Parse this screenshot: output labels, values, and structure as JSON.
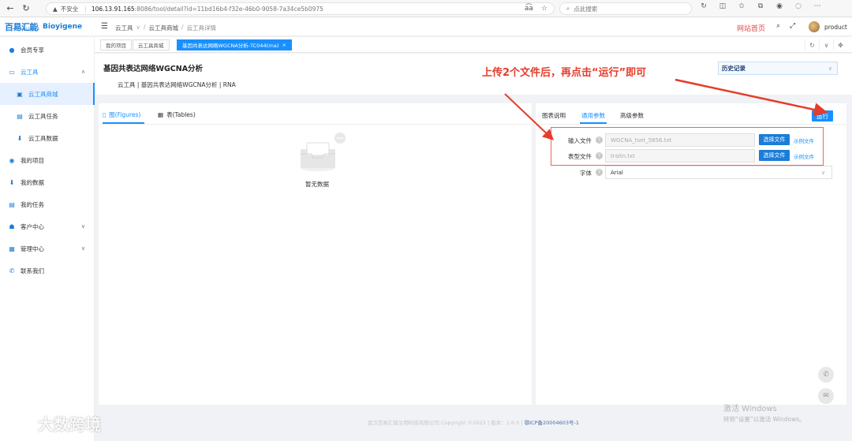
{
  "browser": {
    "insecure_label": "不安全",
    "url_host": "106.13.91.165",
    "url_path": ":8086/tool/detail?id=11bd16b4-f32e-46b0-9058-7a34ce5b0975",
    "search_placeholder": "点此搜索"
  },
  "header": {
    "logo_cn": "百易汇能",
    "logo_sub": "BIOYIGENE",
    "logo_en": "Bioyigene",
    "breadcrumb": [
      "云工具",
      "云工具商城",
      "云工具详情"
    ],
    "site_home": "网站首页",
    "user_name": "product"
  },
  "tabs": [
    {
      "label": "我的项目"
    },
    {
      "label": "云工具商城"
    },
    {
      "label": "基因共表达网络WGCNA分析-TC044(rna)"
    }
  ],
  "sidebar": {
    "items": [
      {
        "label": "会员专享",
        "icon": "member-icon"
      },
      {
        "label": "云工具",
        "icon": "cloud-icon"
      },
      {
        "label": "云工具商城",
        "icon": "store-icon"
      },
      {
        "label": "云工具任务",
        "icon": "task-icon"
      },
      {
        "label": "云工具数据",
        "icon": "data-icon"
      },
      {
        "label": "我的项目",
        "icon": "project-icon"
      },
      {
        "label": "我的数据",
        "icon": "mydata-icon"
      },
      {
        "label": "我的任务",
        "icon": "mytask-icon"
      },
      {
        "label": "客户中心",
        "icon": "customer-icon"
      },
      {
        "label": "管理中心",
        "icon": "admin-icon"
      },
      {
        "label": "联系我们",
        "icon": "contact-icon"
      }
    ]
  },
  "tool": {
    "title": "基因共表达网络WGCNA分析",
    "tags": "云工具 | 基因共表达网络WGCNA分析 | RNA",
    "history_label": "历史记录"
  },
  "annotation": "上传2个文件后，再点击“运行”即可",
  "left_panel": {
    "tab_figures": "图(Figures)",
    "tab_tables": "表(Tables)",
    "empty_text": "暂无数据"
  },
  "right_panel": {
    "tabs": [
      "图表说明",
      "通用参数",
      "高级参数"
    ],
    "run_label": "运行",
    "fields": [
      {
        "label": "输入文件",
        "value": "WGCNA_tset_5856.txt",
        "button": "选择文件",
        "link": "示例文件"
      },
      {
        "label": "表型文件",
        "value": "traitn.txt",
        "button": "选择文件",
        "link": "示例文件"
      }
    ],
    "font_label": "字体",
    "font_value": "Arial"
  },
  "footer": {
    "copyright": "武汉百易汇能生物科技有限公司 Copyright ©2023 | 版本：1.6.0 |",
    "icp": "鄂ICP备20004603号-1"
  },
  "windows": {
    "line1": "激活 Windows",
    "line2": "转到“设置”以激活 Windows。"
  },
  "watermark": "大数跨境",
  "colors": {
    "primary": "#1890ff",
    "annotation": "#e53c2b",
    "site_home": "#e04a4a"
  }
}
